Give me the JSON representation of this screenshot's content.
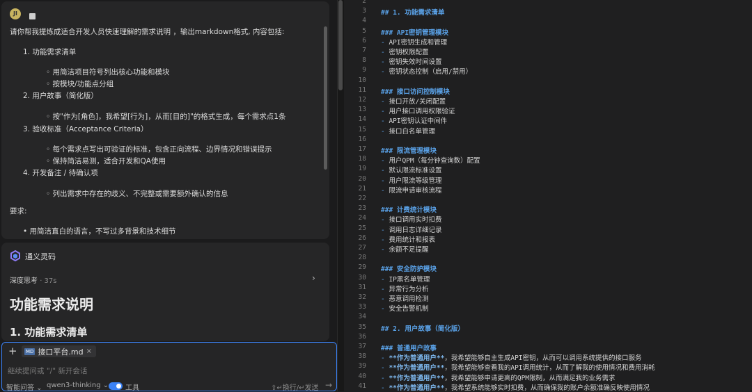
{
  "user_message": {
    "avatar_text": "JI",
    "intro": "请你帮我提炼成适合开发人员快速理解的需求说明 ，输出markdown格式, 内容包括:",
    "items": [
      {
        "title": "1. 功能需求清单",
        "subs": [
          "用简洁项目符号列出核心功能和模块",
          "按模块/功能点分组"
        ]
      },
      {
        "title": "2. 用户故事（简化版）",
        "subs": [
          "按\"作为[角色]，我希望[行为]，从而[目的]\"的格式生成，每个需求点1条"
        ]
      },
      {
        "title": "3. 验收标准（Acceptance Criteria）",
        "subs": [
          "每个需求点写出可验证的标准，包含正向流程、边界情况和错误提示",
          "保持简洁易测，适合开发和QA使用"
        ]
      },
      {
        "title": "4. 开发备注 / 待确认项",
        "subs": [
          "列出需求中存在的歧义、不完整或需要额外确认的信息"
        ]
      }
    ],
    "req_label": "要求:",
    "req_items": [
      "用简洁直白的语言，不写过多背景和技术细节"
    ]
  },
  "assistant": {
    "name": "通义灵码",
    "thinking_label": "深度思考",
    "thinking_time": "· 37s",
    "h1": "功能需求说明",
    "h2": "1. 功能需求清单"
  },
  "input": {
    "file_chip": "接口平台.md",
    "placeholder": "继续提问或 \"/\" 新开会话",
    "mode": "智能问答",
    "model": "qwen3-thinking",
    "tools": "工具",
    "hint": "⇧↵换行/↵发送"
  },
  "editor": {
    "lines": [
      {
        "n": "2",
        "kind": "blank",
        "text": ""
      },
      {
        "n": "3",
        "kind": "h",
        "text": "## 1. 功能需求清单"
      },
      {
        "n": "4",
        "kind": "blank",
        "text": ""
      },
      {
        "n": "5",
        "kind": "h",
        "text": "### API密钥管理模块"
      },
      {
        "n": "6",
        "kind": "item",
        "text": "API密钥生成和管理"
      },
      {
        "n": "7",
        "kind": "item",
        "text": "密钥权限配置"
      },
      {
        "n": "8",
        "kind": "item",
        "text": "密钥失效时间设置"
      },
      {
        "n": "9",
        "kind": "item",
        "text": "密钥状态控制（启用/禁用）"
      },
      {
        "n": "10",
        "kind": "blank",
        "text": ""
      },
      {
        "n": "11",
        "kind": "h",
        "text": "### 接口访问控制模块"
      },
      {
        "n": "12",
        "kind": "item",
        "text": "接口开放/关闭配置"
      },
      {
        "n": "13",
        "kind": "item",
        "text": "用户接口调用权限验证"
      },
      {
        "n": "14",
        "kind": "item",
        "text": "API密钥认证中间件"
      },
      {
        "n": "15",
        "kind": "item",
        "text": "接口白名单管理"
      },
      {
        "n": "16",
        "kind": "blank",
        "text": ""
      },
      {
        "n": "17",
        "kind": "h",
        "text": "### 限流管理模块"
      },
      {
        "n": "18",
        "kind": "item",
        "text": "用户QPM（每分钟查询数）配置"
      },
      {
        "n": "19",
        "kind": "item",
        "text": "默认限流标准设置"
      },
      {
        "n": "20",
        "kind": "item",
        "text": "用户限流等级管理"
      },
      {
        "n": "21",
        "kind": "item",
        "text": "限流申请审核流程"
      },
      {
        "n": "22",
        "kind": "blank",
        "text": ""
      },
      {
        "n": "23",
        "kind": "h",
        "text": "### 计费统计模块"
      },
      {
        "n": "24",
        "kind": "item",
        "text": "接口调用实时扣费"
      },
      {
        "n": "25",
        "kind": "item",
        "text": "调用日志详细记录"
      },
      {
        "n": "26",
        "kind": "item",
        "text": "费用统计和报表"
      },
      {
        "n": "27",
        "kind": "item",
        "text": "余额不足提醒"
      },
      {
        "n": "28",
        "kind": "blank",
        "text": ""
      },
      {
        "n": "29",
        "kind": "h",
        "text": "### 安全防护模块"
      },
      {
        "n": "30",
        "kind": "item",
        "text": "IP黑名单管理"
      },
      {
        "n": "31",
        "kind": "item",
        "text": "异常行为分析"
      },
      {
        "n": "32",
        "kind": "item",
        "text": "恶意调用检测"
      },
      {
        "n": "33",
        "kind": "item",
        "text": "安全告警机制"
      },
      {
        "n": "34",
        "kind": "blank",
        "text": ""
      },
      {
        "n": "35",
        "kind": "h",
        "text": "## 2. 用户故事（简化版）"
      },
      {
        "n": "36",
        "kind": "blank",
        "text": ""
      },
      {
        "n": "37",
        "kind": "h",
        "text": "### 普通用户故事"
      },
      {
        "n": "38",
        "kind": "story",
        "bold": "**作为普通用户**",
        "text": "，我希望能够自主生成API密钥，从而可以调用系统提供的接口服务"
      },
      {
        "n": "39",
        "kind": "story",
        "bold": "**作为普通用户**",
        "text": "，我希望能够查看我的API调用统计，从而了解我的使用情况和费用消耗"
      },
      {
        "n": "40",
        "kind": "story",
        "bold": "**作为普通用户**",
        "text": "，我希望能够申请更高的QPM限制，从而满足我的业务需求"
      },
      {
        "n": "41",
        "kind": "story",
        "bold": "**作为普通用户**",
        "text": "，我希望系统能够实时扣费，从而确保我的账户余额准确反映使用情况"
      }
    ]
  }
}
